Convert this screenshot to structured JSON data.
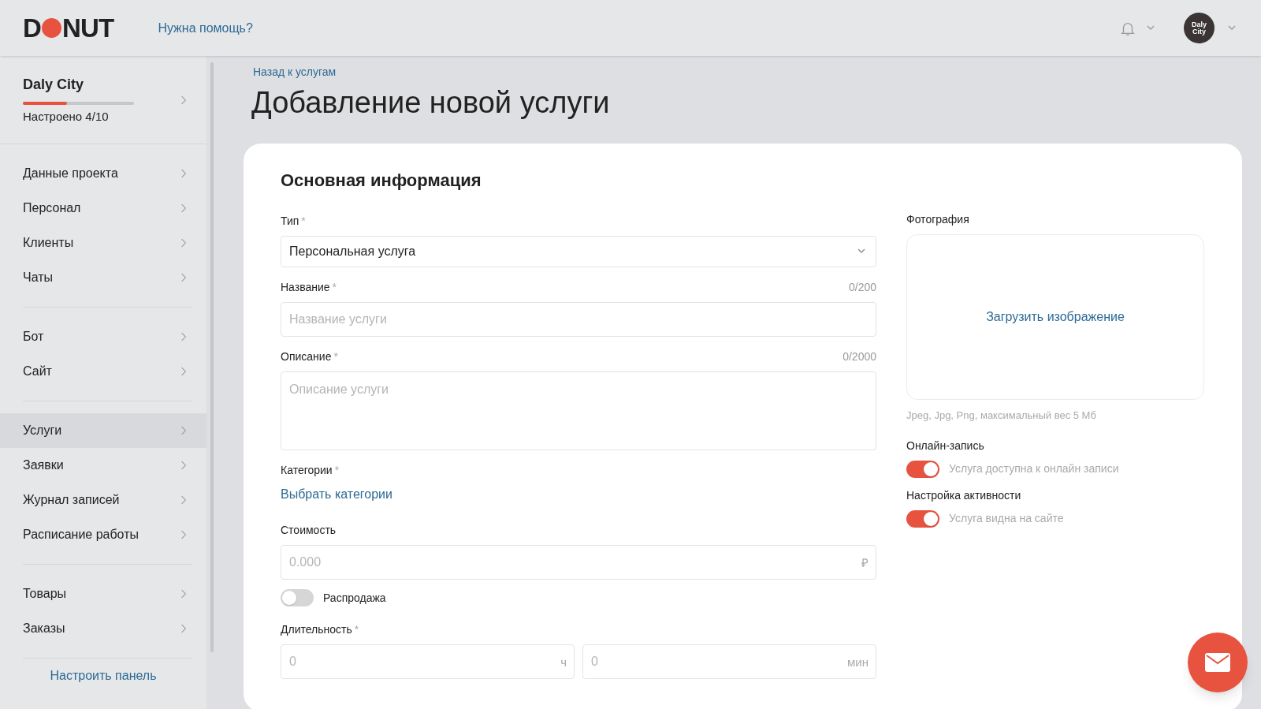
{
  "header": {
    "logo": {
      "start": "D",
      "end": "NUT"
    },
    "help_link": "Нужна помощь?",
    "avatar_label": "Daly City"
  },
  "sidebar": {
    "project": {
      "name": "Daly City",
      "level": 0.4,
      "progress_text": "Настроено 4/10"
    },
    "groups": [
      [
        {
          "label": "Данные проекта",
          "selected": false
        },
        {
          "label": "Персонал",
          "selected": false
        },
        {
          "label": "Клиенты",
          "selected": false
        },
        {
          "label": "Чаты",
          "selected": false
        }
      ],
      [
        {
          "label": "Бот",
          "selected": false
        },
        {
          "label": "Сайт",
          "selected": false
        }
      ],
      [
        {
          "label": "Услуги",
          "selected": true
        },
        {
          "label": "Заявки",
          "selected": false
        },
        {
          "label": "Журнал записей",
          "selected": false
        },
        {
          "label": "Расписание работы",
          "selected": false
        }
      ],
      [
        {
          "label": "Товары",
          "selected": false
        },
        {
          "label": "Заказы",
          "selected": false
        }
      ]
    ],
    "customize_link": "Настроить панель"
  },
  "breadcrumb": "Назад к услугам",
  "page_title": "Добавление новой услуги",
  "card": {
    "title": "Основная информация",
    "fields": [
      {
        "kind": "select",
        "label": "Тип",
        "required_mark": "*",
        "value": "Персональная услуга"
      },
      {
        "kind": "input",
        "label": "Название",
        "required_mark": "*",
        "counter": "0/200",
        "placeholder": "Название услуги"
      },
      {
        "kind": "textarea",
        "label": "Описание",
        "required_mark": "*",
        "counter": "0/2000",
        "placeholder": "Описание услуги"
      },
      {
        "kind": "link",
        "label": "Категории",
        "required_mark": "*",
        "link": "Выбрать категории"
      },
      {
        "kind": "input",
        "label": "Стоимость",
        "placeholder": "0.000",
        "suffix": "₽"
      },
      {
        "kind": "toggle",
        "label": "Распродажа",
        "on": false
      },
      {
        "kind": "pair",
        "label": "Длительность",
        "required_mark": "*",
        "parts": [
          {
            "placeholder": "0",
            "suffix": "ч"
          },
          {
            "placeholder": "0",
            "suffix": "мин"
          }
        ]
      }
    ],
    "photo": {
      "label": "Фотография",
      "upload": "Загрузить изображение",
      "hint": "Jpeg, Jpg, Png, максимальный вес 5 Мб"
    },
    "settings": [
      {
        "label": "Онлайн-запись",
        "toggle_text": "Услуга доступна к онлайн записи",
        "on": true
      },
      {
        "label": "Настройка активности",
        "toggle_text": "Услуга видна на сайте",
        "on": true
      }
    ]
  }
}
